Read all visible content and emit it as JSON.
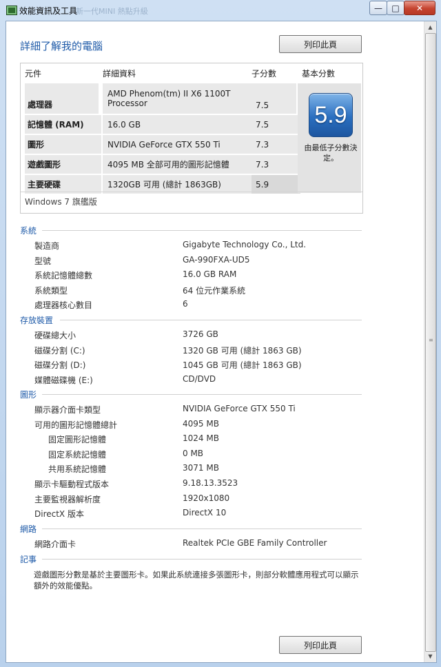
{
  "window": {
    "title": "效能資訊及工具",
    "title_ghost": "新一代MINI 熱點升級"
  },
  "heading": "詳細了解我的電腦",
  "print_label": "列印此頁",
  "table": {
    "headers": {
      "component": "元件",
      "details": "詳細資料",
      "subscore": "子分數",
      "base": "基本分數"
    },
    "rows": [
      {
        "component": "處理器",
        "details": "AMD Phenom(tm) II X6 1100T Processor",
        "subscore": "7.5"
      },
      {
        "component": "記憶體 (RAM)",
        "details": "16.0 GB",
        "subscore": "7.5"
      },
      {
        "component": "圖形",
        "details": "NVIDIA GeForce GTX 550 Ti",
        "subscore": "7.3"
      },
      {
        "component": "遊戲圖形",
        "details": "4095 MB 全部可用的圖形記憶體",
        "subscore": "7.3"
      },
      {
        "component": "主要硬碟",
        "details": "1320GB 可用 (總計 1863GB)",
        "subscore": "5.9"
      }
    ],
    "base_score": "5.9",
    "base_note": "由最低子分數決定。",
    "edition": "Windows 7 旗艦版"
  },
  "sections": {
    "system": {
      "title": "系統",
      "items": [
        {
          "label": "製造商",
          "value": "Gigabyte Technology Co., Ltd."
        },
        {
          "label": "型號",
          "value": "GA-990FXA-UD5"
        },
        {
          "label": "系統記憶體總數",
          "value": "16.0 GB RAM"
        },
        {
          "label": "系統類型",
          "value": "64 位元作業系統"
        },
        {
          "label": "處理器核心數目",
          "value": "6"
        }
      ]
    },
    "storage": {
      "title": "存放裝置",
      "items": [
        {
          "label": "硬碟總大小",
          "value": "3726 GB"
        },
        {
          "label": "磁碟分割 (C:)",
          "value": "1320 GB 可用 (總計 1863 GB)"
        },
        {
          "label": "磁碟分割 (D:)",
          "value": "1045 GB 可用 (總計 1863 GB)"
        },
        {
          "label": "媒體磁碟機 (E:)",
          "value": "CD/DVD"
        }
      ]
    },
    "graphics": {
      "title": "圖形",
      "items": [
        {
          "label": "顯示器介面卡類型",
          "value": "NVIDIA GeForce GTX 550 Ti"
        },
        {
          "label": "可用的圖形記憶體總計",
          "value": "4095 MB"
        },
        {
          "label": "固定圖形記憶體",
          "value": "1024 MB"
        },
        {
          "label": "固定系統記憶體",
          "value": "0 MB"
        },
        {
          "label": "共用系統記憶體",
          "value": "3071 MB"
        },
        {
          "label": "顯示卡驅動程式版本",
          "value": "9.18.13.3523"
        },
        {
          "label": "主要監視器解析度",
          "value": "1920x1080"
        },
        {
          "label": "DirectX 版本",
          "value": "DirectX 10"
        }
      ]
    },
    "network": {
      "title": "網路",
      "items": [
        {
          "label": "網路介面卡",
          "value": "Realtek PCIe GBE Family Controller"
        }
      ]
    },
    "notes": {
      "title": "記事",
      "text": "遊戲圖形分數是基於主要圖形卡。如果此系統連接多張圖形卡，則部分軟體應用程式可以顯示額外的效能優點。"
    }
  },
  "colors": {
    "accent": "#1e5aa8",
    "close": "#c5432f"
  }
}
